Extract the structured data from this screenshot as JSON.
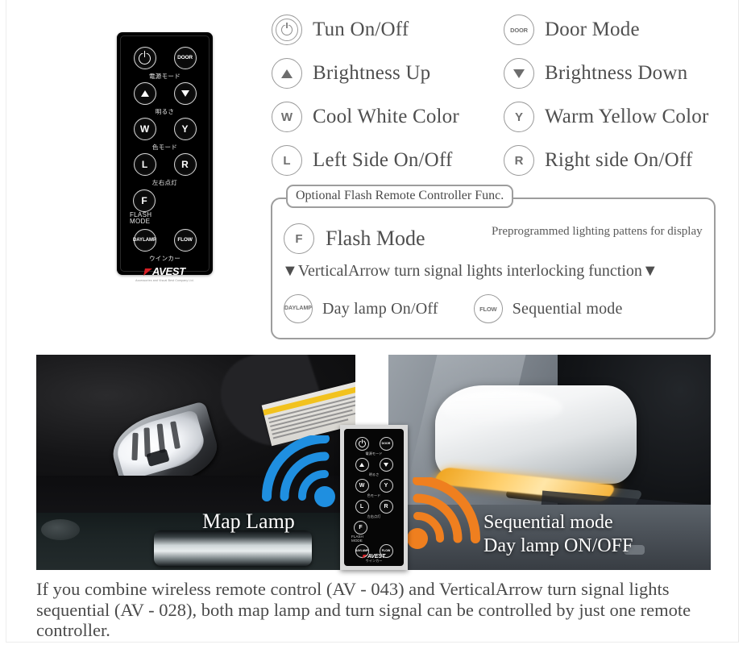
{
  "remote": {
    "brand": "AVEST",
    "brand_sub": "Accessories and Visual Best Company Ltd.",
    "buttons": {
      "power": "power-symbol",
      "door": "DOOR",
      "up": "triangle-up",
      "down": "triangle-down",
      "white": "W",
      "yellow": "Y",
      "left": "L",
      "right": "R",
      "flash": "F",
      "day_lamp_line1": "DAY",
      "day_lamp_line2": "LAMP",
      "flow": "FLOW"
    },
    "labels": {
      "power_mode": "電源モード",
      "brightness": "明るさ",
      "color_mode": "色モード",
      "lr_lighting": "左右点灯",
      "flash_mode_line1": "FLASH",
      "flash_mode_line2": "MODE",
      "winker": "ウインカー"
    }
  },
  "legend": {
    "rows": [
      [
        {
          "icon": "power-icon",
          "glyph": "",
          "label": "Tun On/Off"
        },
        {
          "icon": "door-icon",
          "glyph": "DOOR",
          "label": "Door Mode"
        }
      ],
      [
        {
          "icon": "triangle-up-icon",
          "glyph": "",
          "label": "Brightness Up"
        },
        {
          "icon": "triangle-down-icon",
          "glyph": "",
          "label": "Brightness Down"
        }
      ],
      [
        {
          "icon": "white-color-icon",
          "glyph": "W",
          "label": "Cool White Color"
        },
        {
          "icon": "yellow-color-icon",
          "glyph": "Y",
          "label": "Warm Yellow Color"
        }
      ],
      [
        {
          "icon": "left-side-icon",
          "glyph": "L",
          "label": "Left Side On/Off"
        },
        {
          "icon": "right-side-icon",
          "glyph": "R",
          "label": "Right side On/Off"
        }
      ]
    ]
  },
  "optional_box": {
    "tab_label": "Optional Flash Remote Controller Func.",
    "flash": {
      "glyph": "F",
      "name": "Flash Mode",
      "description": "Preprogrammed lighting pattens for display"
    },
    "interlock_heading": "▼VerticalArrow turn signal lights interlocking function▼",
    "items": [
      {
        "glyph_line1": "DAY",
        "glyph_line2": "LAMP",
        "label": "Day lamp On/Off"
      },
      {
        "glyph": "FLOW",
        "label": "Sequential mode"
      }
    ]
  },
  "photos": {
    "left": {
      "label": "Map Lamp",
      "signal_color": "#1f8fe0"
    },
    "right": {
      "label_line1": "Sequential mode",
      "label_line2": "Day lamp ON/OFF",
      "signal_color": "#ef7f1f"
    }
  },
  "caption": "If you combine wireless remote control (AV - 043) and VerticalArrow turn signal lights sequential (AV - 028), both map lamp and turn signal can be controlled by just one remote controller."
}
